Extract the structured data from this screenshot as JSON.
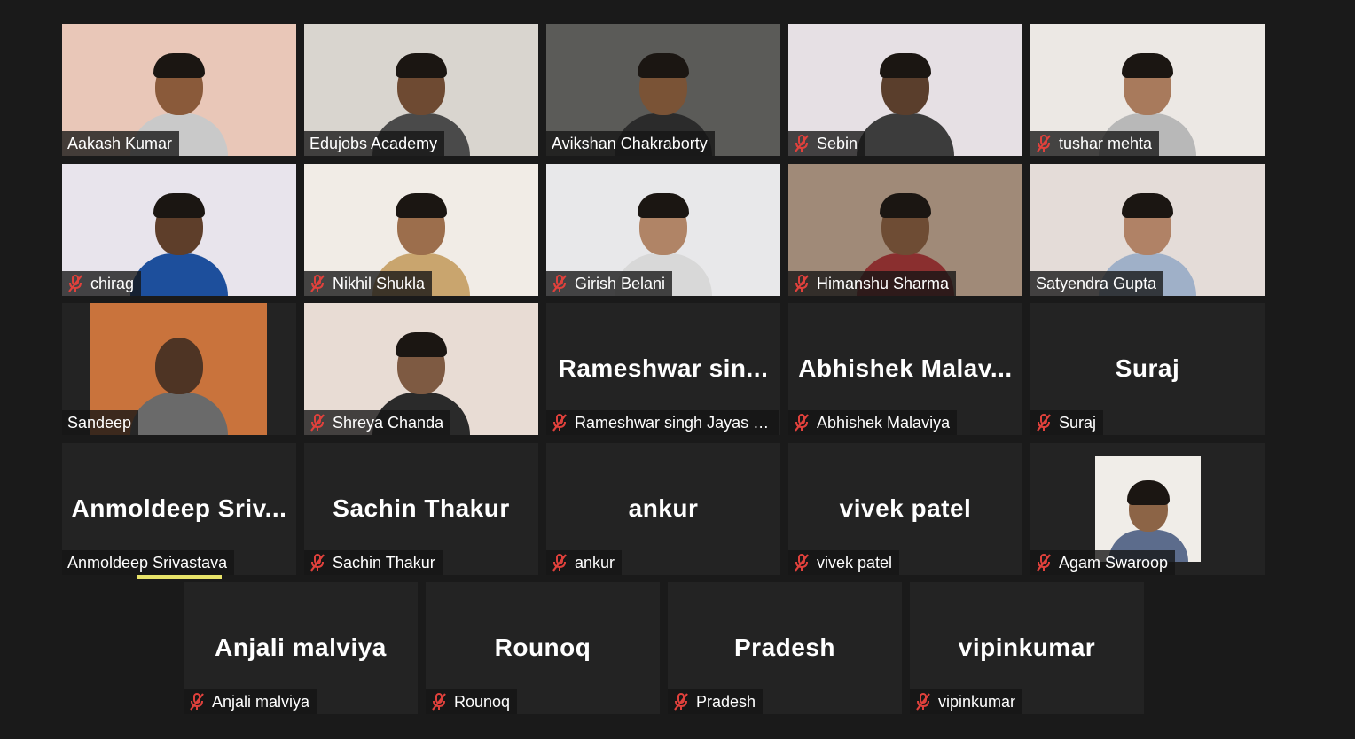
{
  "meeting": {
    "active_speaker_color": "#d8dd5a",
    "muted_icon_color": "#e0413c",
    "participants": [
      {
        "display_name": "Aakash Kumar",
        "muted": false,
        "video": true,
        "bg": "#e9c7b8",
        "skin": "#8a5a3a",
        "shirt": "#c9c9c9"
      },
      {
        "display_name": "Edujobs Academy",
        "muted": false,
        "video": true,
        "active": true,
        "bg": "#d9d5cf",
        "skin": "#6e4a32",
        "shirt": "#4a4a4a"
      },
      {
        "display_name": "Avikshan Chakraborty",
        "muted": false,
        "video": true,
        "bg": "#5b5b58",
        "skin": "#7a5336",
        "shirt": "#2b2b2b"
      },
      {
        "display_name": "Sebin",
        "muted": true,
        "video": true,
        "bg": "#e6e0e4",
        "skin": "#5a3e2c",
        "shirt": "#3c3c3c"
      },
      {
        "display_name": "tushar mehta",
        "muted": true,
        "video": true,
        "bg": "#ece8e4",
        "skin": "#a87a5c",
        "shirt": "#b8b8b8"
      },
      {
        "display_name": "chirag",
        "muted": true,
        "video": true,
        "bg": "#e8e4ec",
        "skin": "#5e3e2a",
        "shirt": "#1d4f9c"
      },
      {
        "display_name": "Nikhil Shukla",
        "muted": true,
        "video": true,
        "bg": "#f1ece6",
        "skin": "#9c6e4c",
        "shirt": "#c9a56e"
      },
      {
        "display_name": "Girish Belani",
        "muted": true,
        "video": true,
        "bg": "#e8e8ea",
        "skin": "#b08466",
        "shirt": "#d8d8d8"
      },
      {
        "display_name": "Himanshu Sharma",
        "muted": true,
        "video": true,
        "bg": "#a08a78",
        "skin": "#6e4c34",
        "shirt": "#8a2f2f"
      },
      {
        "display_name": "Satyendra Gupta",
        "muted": false,
        "video": true,
        "bg": "#e4dcd8",
        "skin": "#b08266",
        "shirt": "#9fb0c8"
      },
      {
        "display_name": "Sandeep",
        "muted": false,
        "video": true,
        "bg": "#c9733c",
        "skin": "#4e3424",
        "shirt": "#6a6a6a"
      },
      {
        "display_name": "Shreya Chanda",
        "muted": true,
        "video": true,
        "bg": "#e8dcd4",
        "skin": "#7e5a42",
        "shirt": "#2a2a2a"
      },
      {
        "display_name": "Rameshwar singh Jayas (...",
        "big_name": "Rameshwar  sin...",
        "muted": true,
        "video": false
      },
      {
        "display_name": "Abhishek Malaviya",
        "big_name": "Abhishek  Malav...",
        "muted": true,
        "video": false
      },
      {
        "display_name": "Suraj",
        "big_name": "Suraj",
        "muted": true,
        "video": false
      },
      {
        "display_name": "Anmoldeep Srivastava",
        "big_name": "Anmoldeep  Sriv...",
        "muted": false,
        "video": false
      },
      {
        "display_name": "Sachin Thakur",
        "big_name": "Sachin Thakur",
        "muted": true,
        "video": false
      },
      {
        "display_name": "ankur",
        "big_name": "ankur",
        "muted": true,
        "video": false
      },
      {
        "display_name": "vivek patel",
        "big_name": "vivek patel",
        "muted": true,
        "video": false
      },
      {
        "display_name": "Agam Swaroop",
        "muted": true,
        "video": true,
        "bg": "#f0ede8",
        "skin": "#8c6446",
        "shirt": "#5c6c8c"
      },
      {
        "display_name": "Anjali malviya",
        "big_name": "Anjali malviya",
        "muted": true,
        "video": false
      },
      {
        "display_name": "Rounoq",
        "big_name": "Rounoq",
        "muted": true,
        "video": false
      },
      {
        "display_name": "Pradesh",
        "big_name": "Pradesh",
        "muted": true,
        "video": false
      },
      {
        "display_name": "vipinkumar",
        "big_name": "vipinkumar",
        "muted": true,
        "video": false
      }
    ]
  }
}
